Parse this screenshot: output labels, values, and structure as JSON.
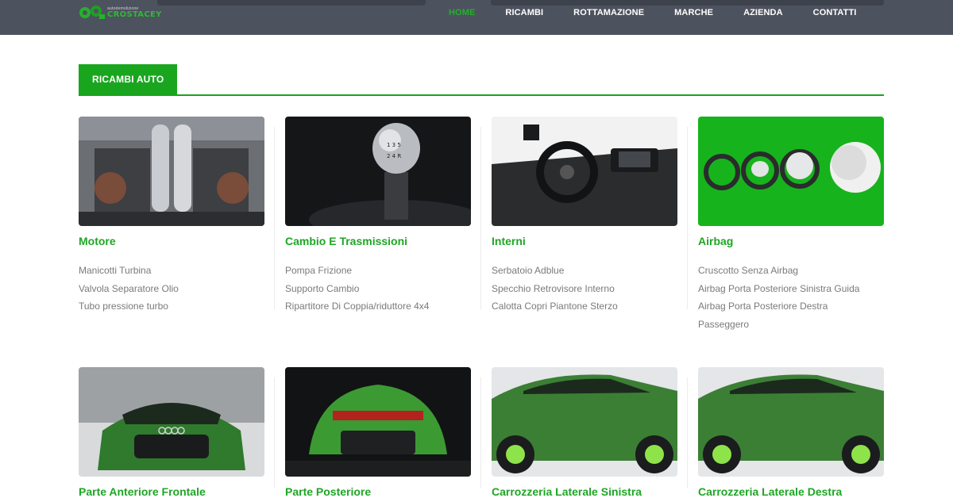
{
  "header": {
    "logo": {
      "tagline": "autodemolizione",
      "brand": "CROSTACEY"
    },
    "nav": [
      {
        "label": "HOME",
        "active": true
      },
      {
        "label": "RICAMBI",
        "active": false
      },
      {
        "label": "ROTTAMAZIONE",
        "active": false
      },
      {
        "label": "MARCHE",
        "active": false
      },
      {
        "label": "AZIENDA",
        "active": false
      },
      {
        "label": "CONTATTI",
        "active": false
      }
    ]
  },
  "section": {
    "title": "RICAMBI AUTO"
  },
  "categories": [
    {
      "title": "Motore",
      "image": "engine-photo",
      "items": [
        "Manicotti Turbina",
        "Valvola Separatore Olio",
        "Tubo pressione turbo"
      ]
    },
    {
      "title": "Cambio E Trasmissioni",
      "image": "gear-shift-photo",
      "items": [
        "Pompa Frizione",
        "Supporto Cambio",
        "Ripartitore Di Coppia/riduttore 4x4"
      ]
    },
    {
      "title": "Interni",
      "image": "car-interior-photo",
      "items": [
        "Serbatoio Adblue",
        "Specchio Retrovisore Interno",
        "Calotta Copri Piantone Sterzo"
      ]
    },
    {
      "title": "Airbag",
      "image": "airbag-photo",
      "items": [
        "Cruscotto Senza Airbag",
        "Airbag Porta Posteriore Sinistra Guida",
        "Airbag Porta Posteriore Destra",
        "Passeggero"
      ]
    },
    {
      "title": "Parte Anteriore Frontale",
      "image": "car-front-photo",
      "items": []
    },
    {
      "title": "Parte Posteriore",
      "image": "car-rear-photo",
      "items": []
    },
    {
      "title": "Carrozzeria Laterale Sinistra",
      "image": "car-left-side-photo",
      "items": []
    },
    {
      "title": "Carrozzeria Laterale Destra",
      "image": "car-right-side-photo",
      "items": []
    }
  ],
  "colors": {
    "accent": "#1ea625",
    "nav_bg": "#4d525f",
    "link_text": "#7a7a7a"
  }
}
